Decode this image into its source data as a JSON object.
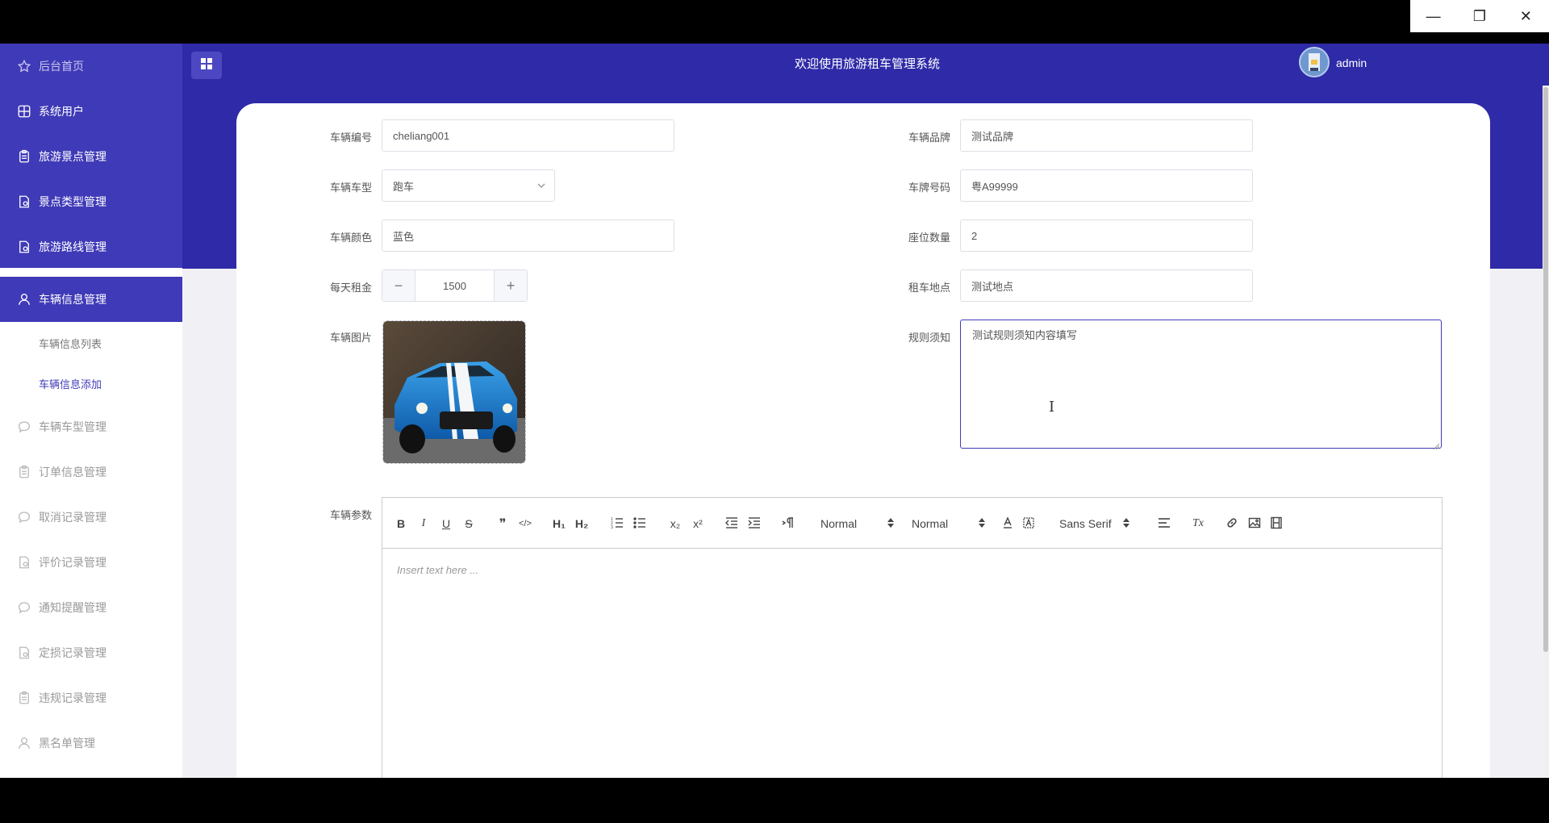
{
  "window": {
    "minimize_glyph": "—",
    "restore_glyph": "❐",
    "close_glyph": "✕"
  },
  "header": {
    "title": "欢迎使用旅游租车管理系统",
    "user_name": "admin"
  },
  "sidebar": {
    "items": [
      {
        "label": "后台首页",
        "icon": "star-icon"
      },
      {
        "label": "系统用户",
        "icon": "grid-icon"
      },
      {
        "label": "旅游景点管理",
        "icon": "clipboard-icon"
      },
      {
        "label": "景点类型管理",
        "icon": "document-icon"
      },
      {
        "label": "旅游路线管理",
        "icon": "document-icon"
      },
      {
        "label": "车辆信息管理",
        "icon": "user-icon"
      },
      {
        "label": "车辆车型管理",
        "icon": "chat-icon"
      },
      {
        "label": "订单信息管理",
        "icon": "clipboard-icon"
      },
      {
        "label": "取消记录管理",
        "icon": "chat-icon"
      },
      {
        "label": "评价记录管理",
        "icon": "document-icon"
      },
      {
        "label": "通知提醒管理",
        "icon": "chat-icon"
      },
      {
        "label": "定损记录管理",
        "icon": "document-icon"
      },
      {
        "label": "违规记录管理",
        "icon": "clipboard-icon"
      },
      {
        "label": "黑名单管理",
        "icon": "user-icon"
      }
    ],
    "submenu": [
      {
        "label": "车辆信息列表"
      },
      {
        "label": "车辆信息添加"
      }
    ]
  },
  "form": {
    "vehicle_no": {
      "label": "车辆编号",
      "value": "cheliang001"
    },
    "brand": {
      "label": "车辆品牌",
      "value": "测试品牌"
    },
    "car_type": {
      "label": "车辆车型",
      "value": "跑车"
    },
    "plate_no": {
      "label": "车牌号码",
      "value": "粤A99999"
    },
    "color": {
      "label": "车辆颜色",
      "value": "蓝色"
    },
    "seats": {
      "label": "座位数量",
      "value": "2"
    },
    "daily_rent": {
      "label": "每天租金",
      "value": "1500",
      "minus": "−",
      "plus": "+"
    },
    "rental_location": {
      "label": "租车地点",
      "value": "测试地点"
    },
    "image": {
      "label": "车辆图片"
    },
    "rules": {
      "label": "规则须知",
      "value": "测试规则须知内容填写"
    },
    "params": {
      "label": "车辆参数"
    }
  },
  "editor": {
    "toolbar": {
      "bold": "B",
      "italic": "I",
      "underline": "U",
      "strike": "S",
      "quote": "❞",
      "code": "</>",
      "h1": "H₁",
      "h2": "H₂",
      "sub": "x₂",
      "sup": "x²",
      "clean": "Tx",
      "header_select": "Normal",
      "size_select": "Normal",
      "font_select": "Sans Serif"
    },
    "placeholder": "Insert text here ..."
  },
  "colors": {
    "primary": "#3f3ab7",
    "header_bg": "#2e2aa8",
    "page_bg": "#f1f1f5"
  }
}
